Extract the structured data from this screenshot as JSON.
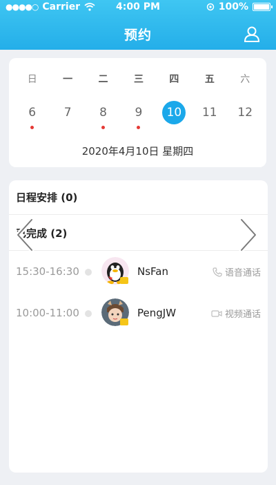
{
  "status": {
    "carrier": "Carrier",
    "time": "4:00 PM",
    "battery": "100%"
  },
  "nav": {
    "title": "预约"
  },
  "calendar": {
    "weekdays": [
      "日",
      "一",
      "二",
      "三",
      "四",
      "五",
      "六"
    ],
    "dates": [
      {
        "day": "6",
        "dot": true
      },
      {
        "day": "7",
        "dot": false
      },
      {
        "day": "8",
        "dot": true
      },
      {
        "day": "9",
        "dot": true
      },
      {
        "day": "10",
        "dot": false,
        "selected": true
      },
      {
        "day": "11",
        "dot": false
      },
      {
        "day": "12",
        "dot": false
      }
    ],
    "selected_date_text": "2020年4月10日   星期四"
  },
  "sections": {
    "schedule": "日程安排 (0)",
    "completed": "已完成 (2)"
  },
  "rows": [
    {
      "time": "15:30-16:30",
      "name": "NsFan",
      "call": "语音通话",
      "call_icon": "phone-icon"
    },
    {
      "time": "10:00-11:00",
      "name": "PengJW",
      "call": "视频通话",
      "call_icon": "video-icon"
    }
  ],
  "colors": {
    "accent": "#1ba8ea",
    "dot": "#e53935"
  }
}
